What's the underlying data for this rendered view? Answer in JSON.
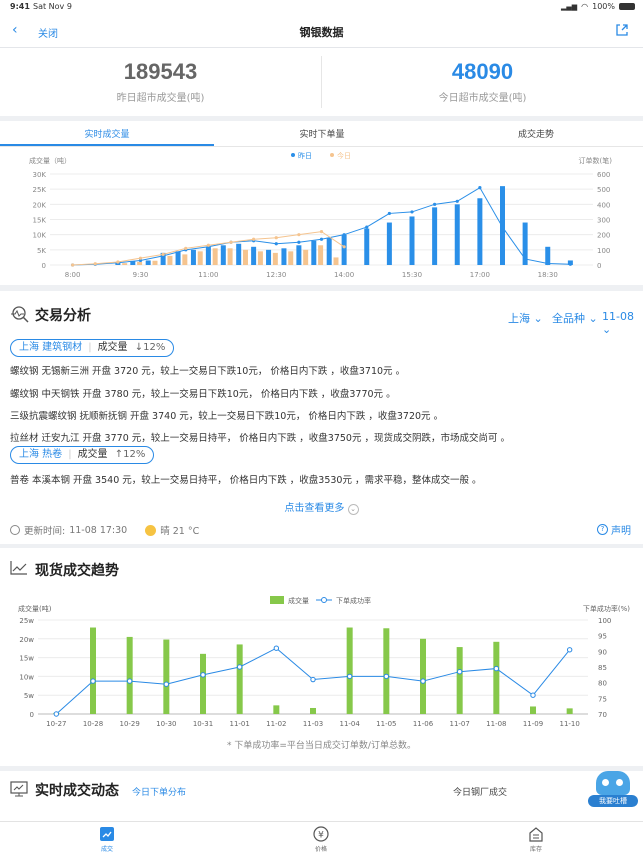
{
  "status": {
    "time": "9:41",
    "date": "Sat Nov 9",
    "battery": "100%"
  },
  "nav": {
    "back_label": "关闭",
    "title": "钢银数据"
  },
  "stats": {
    "yesterday": {
      "value": "189543",
      "label": "昨日超市成交量(吨)"
    },
    "today": {
      "value": "48090",
      "label": "今日超市成交量(吨)"
    }
  },
  "tabs": [
    "实时成交量",
    "实时下单量",
    "成交走势"
  ],
  "chart1_ui": {
    "ylabel": "成交量（吨）",
    "y2label": "订单数(笔)",
    "legend": [
      "昨日",
      "今日"
    ]
  },
  "chart_data": [
    {
      "type": "bar",
      "xlabel": "",
      "ylabel": "成交量（吨）",
      "y2label": "订单数(笔)",
      "ylim": [
        0,
        30000
      ],
      "y2lim": [
        0,
        600
      ],
      "yticks": [
        "0",
        "5K",
        "10K",
        "15K",
        "20K",
        "25K",
        "30K"
      ],
      "y2ticks": [
        "0",
        "100",
        "200",
        "300",
        "400",
        "500",
        "600"
      ],
      "xticks": [
        "8:00",
        "9:30",
        "11:00",
        "12:30",
        "14:00",
        "15:30",
        "17:00",
        "18:30"
      ],
      "legend": [
        "昨日",
        "今日"
      ],
      "series": [
        {
          "name": "昨日",
          "type": "bar",
          "color": "#2a8fe8",
          "x": [
            9.0,
            9.33,
            9.67,
            10.0,
            10.33,
            10.67,
            11.0,
            11.33,
            11.67,
            12.0,
            12.33,
            12.67,
            13.0,
            13.33,
            13.67,
            14.0,
            14.5,
            15.0,
            15.5,
            16.0,
            16.5,
            17.0,
            17.5,
            18.0,
            18.5,
            19.0
          ],
          "values": [
            700,
            1200,
            1500,
            4000,
            4500,
            5000,
            6000,
            6500,
            7000,
            6000,
            5000,
            5500,
            6500,
            8000,
            9000,
            10000,
            12000,
            14000,
            16000,
            19000,
            20000,
            22000,
            26000,
            14000,
            6000,
            1500
          ]
        },
        {
          "name": "今日",
          "type": "bar",
          "color": "#f5c48f",
          "x": [
            9.15,
            9.48,
            9.82,
            10.15,
            10.48,
            10.82,
            11.15,
            11.48,
            11.82,
            12.15,
            12.48,
            12.82,
            13.15,
            13.48,
            13.82
          ],
          "values": [
            600,
            1000,
            1400,
            3000,
            3500,
            4500,
            5500,
            5500,
            5000,
            4500,
            4000,
            4500,
            5000,
            6500,
            2500
          ]
        },
        {
          "name": "昨日",
          "type": "line",
          "axis": "right",
          "color": "#2a8fe8",
          "x": [
            8.0,
            8.5,
            9.0,
            9.5,
            10.0,
            10.5,
            11.0,
            11.5,
            12.0,
            12.5,
            13.0,
            13.5,
            14.0,
            14.5,
            15.0,
            15.5,
            16.0,
            16.5,
            17.0,
            17.5,
            18.0,
            18.5,
            19.0
          ],
          "values": [
            0,
            5,
            15,
            30,
            60,
            100,
            120,
            150,
            160,
            140,
            150,
            170,
            200,
            250,
            340,
            350,
            400,
            420,
            510,
            250,
            40,
            10,
            5
          ]
        },
        {
          "name": "今日",
          "type": "line",
          "axis": "right",
          "color": "#f5c48f",
          "x": [
            8.0,
            8.5,
            9.0,
            9.5,
            10.0,
            10.5,
            11.0,
            11.5,
            12.0,
            12.5,
            13.0,
            13.5,
            14.0
          ],
          "values": [
            0,
            8,
            20,
            45,
            70,
            110,
            130,
            150,
            170,
            180,
            200,
            220,
            120
          ]
        }
      ]
    },
    {
      "type": "bar",
      "xlabel": "",
      "ylabel": "成交量(吨)",
      "y2label": "下单成功率(%)",
      "ylim": [
        0,
        25000
      ],
      "y2lim": [
        70,
        100
      ],
      "yticks": [
        "0",
        "5w",
        "10w",
        "15w",
        "20w",
        "25w"
      ],
      "y2ticks": [
        "70",
        "75",
        "80",
        "85",
        "90",
        "95",
        "100"
      ],
      "categories": [
        "10-27",
        "10-28",
        "10-29",
        "10-30",
        "10-31",
        "11-01",
        "11-02",
        "11-03",
        "11-04",
        "11-05",
        "11-06",
        "11-07",
        "11-08",
        "11-09",
        "11-10"
      ],
      "legend": [
        "成交量",
        "下单成功率"
      ],
      "series": [
        {
          "name": "成交量",
          "type": "bar",
          "color": "#86c84a",
          "values": [
            300,
            23000,
            20500,
            19800,
            16000,
            18500,
            2300,
            1600,
            23000,
            22800,
            20000,
            17800,
            19200,
            2000,
            1500
          ]
        },
        {
          "name": "下单成功率",
          "type": "line",
          "axis": "right",
          "color": "#2a8ae5",
          "values": [
            70,
            80.5,
            80.5,
            79.5,
            82.5,
            85,
            91,
            81,
            82,
            82,
            80.5,
            83.5,
            84.5,
            76,
            90.5
          ]
        }
      ]
    }
  ],
  "analysis": {
    "title": "交易分析",
    "filters": [
      "上海",
      "全品种",
      "11-08"
    ],
    "group1": {
      "city": "上海 建筑钢材",
      "metric": "成交量",
      "change": "↓12%"
    },
    "group1_lines": [
      "螺纹钢 无锡新三洲 开盘 3720 元，较上一交易日下跌10元， 价格日内下跌 ，收盘3710元 。",
      "螺纹钢 中天钢铁 开盘 3780 元，较上一交易日下跌10元， 价格日内下跌 ，收盘3770元 。",
      "三级抗震螺纹钢 抚顺新抚钢 开盘 3740 元，较上一交易日下跌10元， 价格日内下跌 ，收盘3720元 。",
      "拉丝材 迁安九江 开盘 3770 元，较上一交易日持平， 价格日内下跌 ，收盘3750元 ，现货成交阴跌，市场成交尚可 。"
    ],
    "group2": {
      "city": "上海 热卷",
      "metric": "成交量",
      "change": "↑12%"
    },
    "group2_lines": [
      "普卷 本溪本钢 开盘 3540 元，较上一交易日持平， 价格日内下跌 ，收盘3530元 ，需求平稳，整体成交一般 。"
    ],
    "more": "点击查看更多",
    "update_label": "更新时间:",
    "update_time": "11-08 17:30",
    "weather": "晴 21 °C",
    "statement": "声明"
  },
  "trend": {
    "title": "现货成交趋势",
    "legend_bar": "成交量",
    "legend_line": "下单成功率",
    "ylabel": "成交量(吨)",
    "y2label": "下单成功率(%)",
    "footnote": "* 下单成功率=平台当日成交订单数/订单总数。"
  },
  "dynamic": {
    "title": "实时成交动态",
    "sub_left": "今日下单分布",
    "sub_right": "今日钢厂成交",
    "feedback": "我要吐槽"
  },
  "tabbar": [
    "成交",
    "价格",
    "库存"
  ],
  "colors": {
    "accent": "#2a8ae5",
    "today_orange": "#f5c48f",
    "bar_green": "#86c84a"
  }
}
